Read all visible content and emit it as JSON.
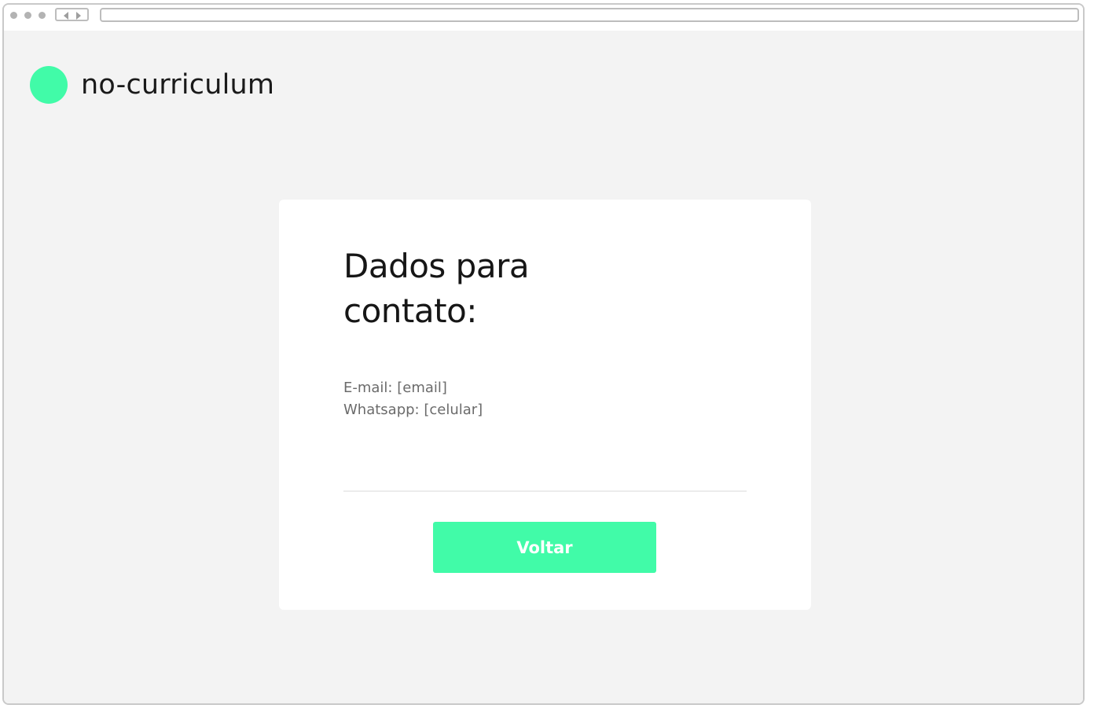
{
  "browser": {
    "address_value": ""
  },
  "header": {
    "brand_name": "no-curriculum",
    "logo_icon": "green-circle-logo"
  },
  "card": {
    "title": "Dados para contato:",
    "contact": {
      "email_line": "E-mail: [email]",
      "whatsapp_line": "Whatsapp: [celular]"
    },
    "back_button_label": "Voltar"
  },
  "colors": {
    "accent": "#41fba8",
    "page_background": "#f3f3f3",
    "card_background": "#ffffff",
    "title_text": "#161616",
    "muted_text": "#6b6b6b"
  }
}
